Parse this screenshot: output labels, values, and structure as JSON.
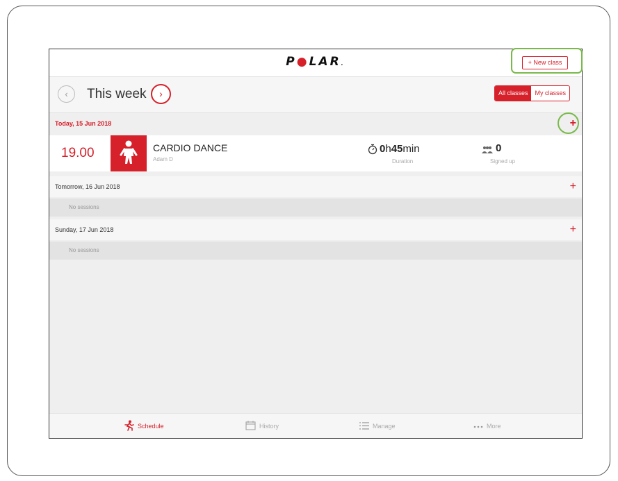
{
  "app": {
    "logo_text": "POLAR",
    "accent_color": "#d6202a",
    "highlight_color": "#79b94a"
  },
  "header": {
    "new_class_label": "+ New class"
  },
  "week_nav": {
    "title": "This week",
    "prev_icon": "chevron-left-icon",
    "next_icon": "chevron-right-icon",
    "filters": [
      {
        "label": "All classes",
        "selected": true
      },
      {
        "label": "My classes",
        "selected": false
      }
    ]
  },
  "days": [
    {
      "header": "Today, 15 Jun 2018",
      "is_today": true,
      "classes": [
        {
          "time": "19.00",
          "name": "CARDIO DANCE",
          "instructor": "Adam D",
          "duration_hours": "0",
          "duration_h_unit": "h",
          "duration_minutes": "45",
          "duration_min_unit": "min",
          "duration_label": "Duration",
          "signed_up": "0",
          "signed_up_label": "Signed up"
        }
      ]
    },
    {
      "header": "Tomorrow, 16 Jun 2018",
      "is_today": false,
      "empty_text": "No sessions"
    },
    {
      "header": "Sunday, 17 Jun 2018",
      "is_today": false,
      "empty_text": "No sessions"
    }
  ],
  "tabs": [
    {
      "label": "Schedule",
      "icon": "runner-icon",
      "active": true
    },
    {
      "label": "History",
      "icon": "calendar-icon",
      "active": false
    },
    {
      "label": "Manage",
      "icon": "list-icon",
      "active": false
    },
    {
      "label": "More",
      "icon": "more-dots-icon",
      "active": false
    }
  ]
}
